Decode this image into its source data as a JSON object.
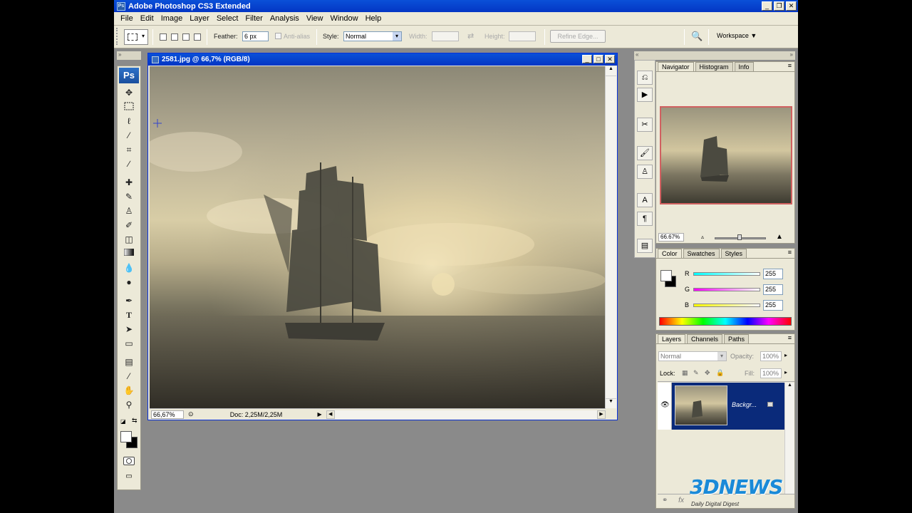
{
  "window": {
    "title": "Adobe Photoshop CS3 Extended",
    "app_icon": "Ps",
    "min": "_",
    "restore": "❐",
    "close": "✕"
  },
  "menu": [
    "File",
    "Edit",
    "Image",
    "Layer",
    "Select",
    "Filter",
    "Analysis",
    "View",
    "Window",
    "Help"
  ],
  "options": {
    "feather_label": "Feather:",
    "feather_value": "6 px",
    "antialias_label": "Anti-alias",
    "style_label": "Style:",
    "style_value": "Normal",
    "width_label": "Width:",
    "height_label": "Height:",
    "refine_edge": "Refine Edge...",
    "workspace": "Workspace"
  },
  "toolbox": {
    "logo": "Ps"
  },
  "document": {
    "title": "2581.jpg @ 66,7% (RGB/8)",
    "zoom": "66,67%",
    "doc_info": "Doc: 2,25M/2,25M"
  },
  "navigator": {
    "tabs": [
      "Navigator",
      "Histogram",
      "Info"
    ],
    "zoom": "66.67%"
  },
  "color": {
    "tabs": [
      "Color",
      "Swatches",
      "Styles"
    ],
    "channels": [
      {
        "label": "R",
        "value": "255",
        "color": "#3ad7e8"
      },
      {
        "label": "G",
        "value": "255",
        "color": "#e04ad0"
      },
      {
        "label": "B",
        "value": "255",
        "color": "#e8e84a"
      }
    ]
  },
  "layers": {
    "tabs": [
      "Layers",
      "Channels",
      "Paths"
    ],
    "blend_mode": "Normal",
    "opacity_label": "Opacity:",
    "opacity": "100%",
    "lock_label": "Lock:",
    "fill_label": "Fill:",
    "fill": "100%",
    "layer_name": "Backgr..."
  },
  "watermark": {
    "main": "3DNEWS",
    "sub": "Daily Digital Digest"
  },
  "colors": {
    "titlebar": "#0a50d8",
    "panel_bg": "#ece9d8",
    "selected_layer": "#0a2a7a"
  }
}
